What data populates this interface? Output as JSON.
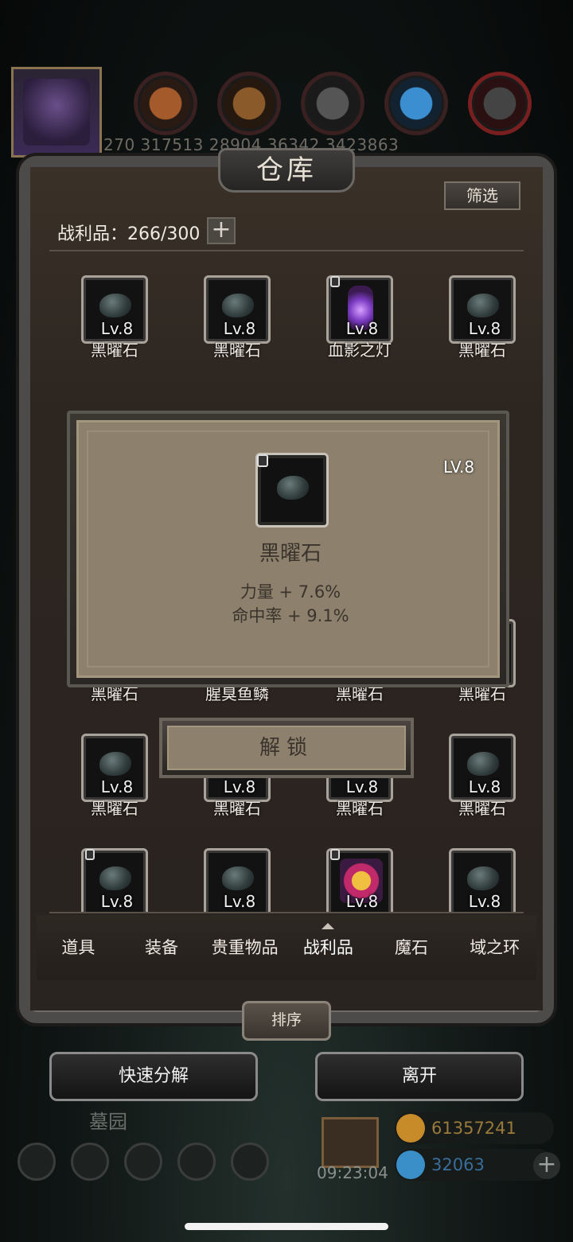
{
  "top_bar": {
    "resource_values": "270  317513  28904  36342  3423863"
  },
  "warehouse": {
    "title": "仓库",
    "filter_label": "筛选",
    "capacity_text": "战利品：266/300",
    "capacity_plus": "+",
    "items": [
      {
        "level": "Lv.8",
        "name": "黑曜石",
        "icon": "obsidian-stone-icon",
        "locked": false
      },
      {
        "level": "Lv.8",
        "name": "黑曜石",
        "icon": "obsidian-stone-icon",
        "locked": false
      },
      {
        "level": "Lv.8",
        "name": "血影之灯",
        "icon": "blood-shadow-lamp-icon",
        "locked": true
      },
      {
        "level": "Lv.8",
        "name": "黑曜石",
        "icon": "obsidian-stone-icon",
        "locked": false
      },
      {
        "level": "Lv.8",
        "name": "黑曜石",
        "icon": "obsidian-stone-icon",
        "locked": false
      },
      {
        "level": "Lv.8",
        "name": "腥臭鱼鳞",
        "icon": "fish-scale-icon",
        "locked": false
      },
      {
        "level": "Lv.8",
        "name": "黑曜石",
        "icon": "obsidian-stone-icon",
        "locked": false
      },
      {
        "level": "Lv.8",
        "name": "黑曜石",
        "icon": "obsidian-stone-icon",
        "locked": false
      },
      {
        "level": "Lv.8",
        "name": "黑曜石",
        "icon": "obsidian-stone-icon",
        "locked": false
      },
      {
        "level": "Lv.8",
        "name": "黑曜石",
        "icon": "obsidian-stone-icon",
        "locked": false
      },
      {
        "level": "Lv.8",
        "name": "黑曜石",
        "icon": "obsidian-stone-icon",
        "locked": false
      },
      {
        "level": "Lv.8",
        "name": "黑曜石",
        "icon": "obsidian-stone-icon",
        "locked": false
      },
      {
        "level": "Lv.8",
        "name": "",
        "icon": "obsidian-stone-icon",
        "locked": true
      },
      {
        "level": "Lv.8",
        "name": "",
        "icon": "obsidian-stone-icon",
        "locked": false
      },
      {
        "level": "Lv.8",
        "name": "",
        "icon": "medal-ix-icon",
        "locked": true
      },
      {
        "level": "Lv.8",
        "name": "",
        "icon": "obsidian-stone-icon",
        "locked": false
      }
    ],
    "tabs": [
      "道具",
      "装备",
      "贵重物品",
      "战利品",
      "魔石",
      "域之环"
    ],
    "active_tab": "战利品",
    "sort_label": "排序"
  },
  "actions": {
    "quick_decompose": "快速分解",
    "leave": "离开"
  },
  "detail": {
    "level": "LV.8",
    "name": "黑曜石",
    "stat1": "力量 + 7.6%",
    "stat2": "命中率 + 9.1%",
    "unlock_label": "解锁"
  },
  "background": {
    "location": "墓园",
    "timer": "09:23:04",
    "gold": "61357241",
    "gems": "32063",
    "plus": "+"
  }
}
